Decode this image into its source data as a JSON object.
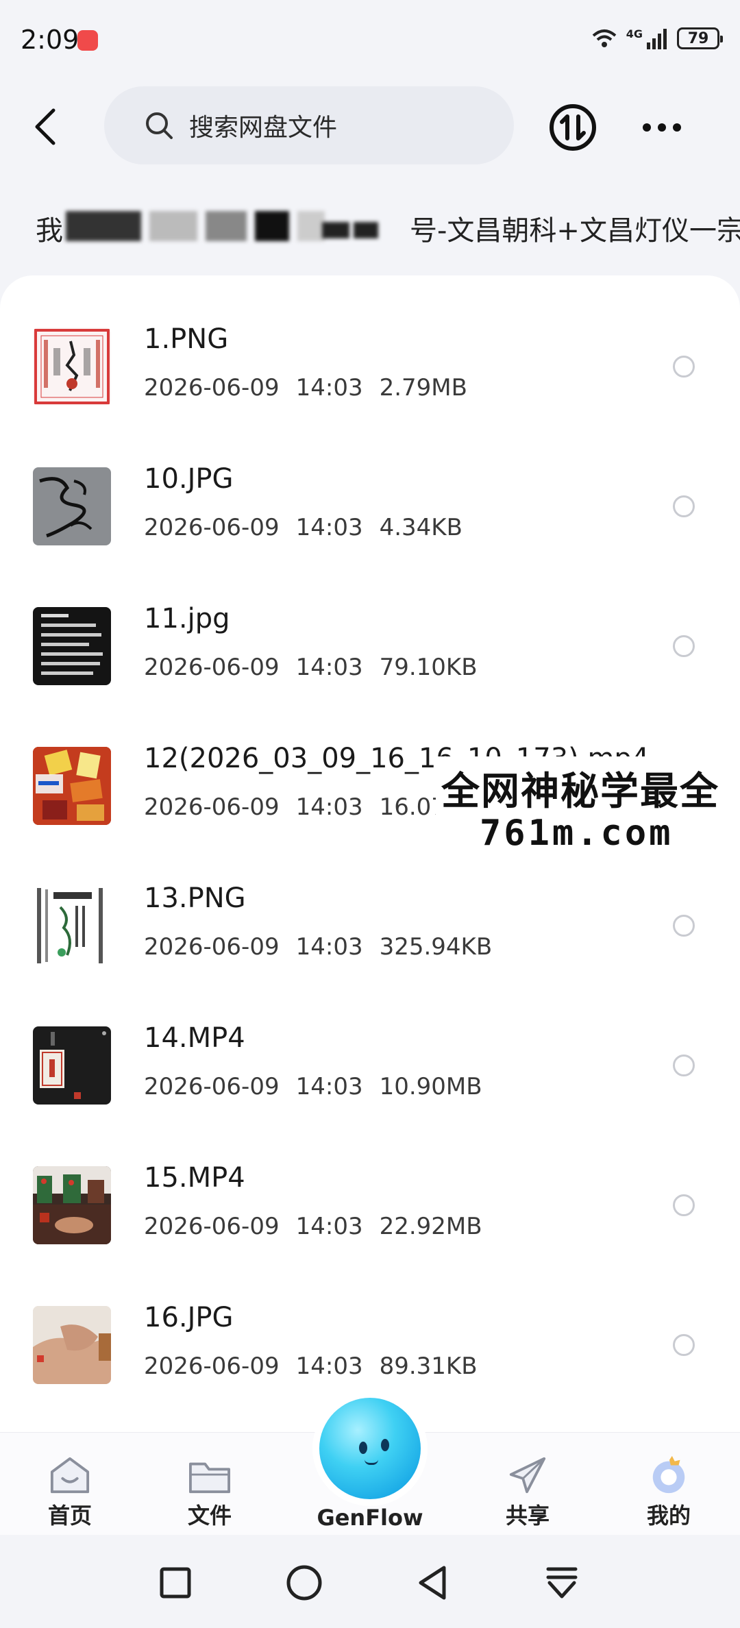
{
  "status_bar": {
    "time": "2:09",
    "network": "4G",
    "battery": "79"
  },
  "header": {
    "search_placeholder": "搜索网盘文件"
  },
  "breadcrumb": {
    "prefix": "我",
    "visible_text": "号-文昌朝科+文昌灯仪一宗"
  },
  "files": [
    {
      "name": "1.PNG",
      "date": "2026-06-09",
      "time": "14:03",
      "size": "2.79MB",
      "thumb": "talisman-red"
    },
    {
      "name": "10.JPG",
      "date": "2026-06-09",
      "time": "14:03",
      "size": "4.34KB",
      "thumb": "brush-stroke"
    },
    {
      "name": "11.jpg",
      "date": "2026-06-09",
      "time": "14:03",
      "size": "79.10KB",
      "thumb": "dark-text"
    },
    {
      "name": "12(2026_03_09_16_16_10_173).mp4",
      "date": "2026-06-09",
      "time": "14:03",
      "size": "16.07",
      "thumb": "colorful-video"
    },
    {
      "name": "13.PNG",
      "date": "2026-06-09",
      "time": "14:03",
      "size": "325.94KB",
      "thumb": "scroll-doc"
    },
    {
      "name": "14.MP4",
      "date": "2026-06-09",
      "time": "14:03",
      "size": "10.90MB",
      "thumb": "dark-video"
    },
    {
      "name": "15.MP4",
      "date": "2026-06-09",
      "time": "14:03",
      "size": "22.92MB",
      "thumb": "altar-video"
    },
    {
      "name": "16.JPG",
      "date": "2026-06-09",
      "time": "14:03",
      "size": "89.31KB",
      "thumb": "hands-photo"
    }
  ],
  "watermark": {
    "line1": "全网神秘学最全",
    "line2": "761m.com"
  },
  "tabbar": {
    "home": "首页",
    "files": "文件",
    "genflow": "GenFlow",
    "share": "共享",
    "me": "我的"
  },
  "colors": {
    "page_bg": "#f3f4f8",
    "card_bg": "#ffffff",
    "search_bg": "#e9ebf1",
    "accent_ball": "#3fd0f3"
  }
}
